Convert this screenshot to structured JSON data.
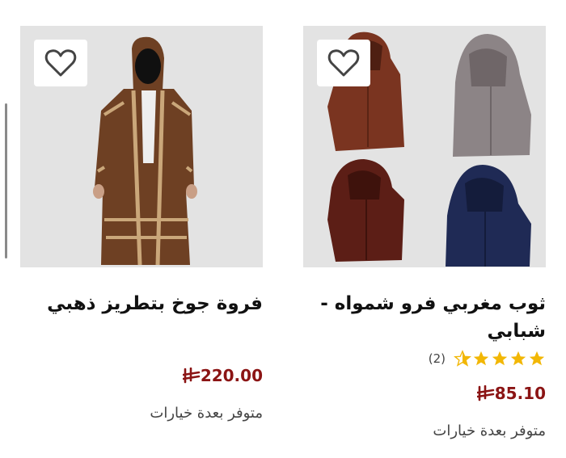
{
  "colors": {
    "price": "#8b1414",
    "star": "#f2b705",
    "image_bg": "#e3e3e3"
  },
  "products": [
    {
      "title": "ثوب مغربي فرو شمواه - شبابي",
      "rating": {
        "stars": 4.5,
        "max": 5,
        "count": "(2)"
      },
      "price": "85.10",
      "currency_icon": "riyal-icon",
      "availability": "متوفر بعدة خيارات",
      "wishlist_icon": "heart-icon"
    },
    {
      "title": "فروة جوخ بتطريز ذهبي",
      "price": "220.00",
      "currency_icon": "riyal-icon",
      "availability": "متوفر بعدة خيارات",
      "wishlist_icon": "heart-icon"
    }
  ]
}
